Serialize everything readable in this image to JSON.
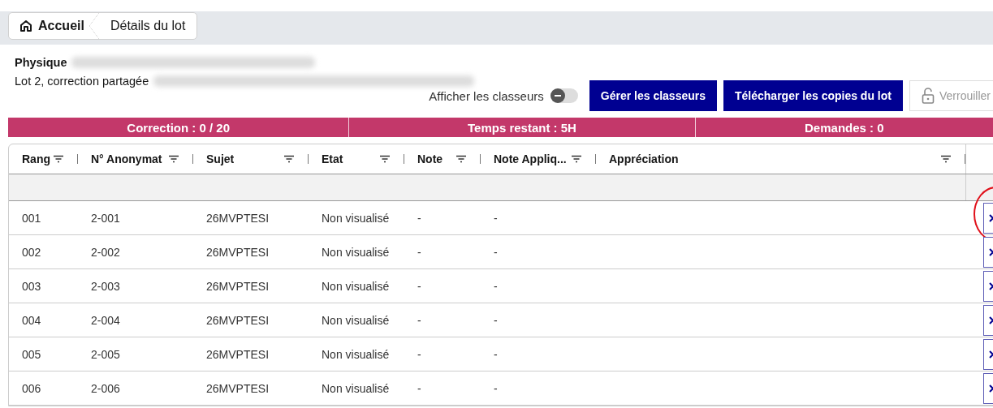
{
  "breadcrumb": [
    {
      "label": "Accueil",
      "kind": "home"
    },
    {
      "label": "Détails du lot",
      "kind": "page"
    }
  ],
  "header": {
    "subject": "Physique",
    "lot": "Lot 2, correction partagée"
  },
  "toolbar": {
    "toggle": {
      "label": "Afficher les classeurs",
      "on": false
    },
    "buttons": [
      {
        "label": "Gérer les classeurs",
        "kind": "primary"
      },
      {
        "label": "Télécharger les copies du lot",
        "kind": "primary"
      },
      {
        "label": "Verrouiller",
        "kind": "lock"
      }
    ]
  },
  "status_bar": [
    "Correction : 0 / 20",
    "Temps restant : 5H",
    "Demandes : 0"
  ],
  "table": {
    "columns": [
      {
        "label": "Rang"
      },
      {
        "label": "N° Anonymat"
      },
      {
        "label": "Sujet"
      },
      {
        "label": "Etat"
      },
      {
        "label": "Note"
      },
      {
        "label": "Note Appliq..."
      },
      {
        "label": "Appréciation"
      }
    ],
    "rows": [
      {
        "cells": [
          "001",
          "2-001",
          "26MVPTESI",
          "Non visualisé",
          "-",
          "-"
        ],
        "highlighted": true
      },
      {
        "cells": [
          "002",
          "2-002",
          "26MVPTESI",
          "Non visualisé",
          "-",
          "-"
        ],
        "highlighted": false
      },
      {
        "cells": [
          "003",
          "2-003",
          "26MVPTESI",
          "Non visualisé",
          "-",
          "-"
        ],
        "highlighted": false
      },
      {
        "cells": [
          "004",
          "2-004",
          "26MVPTESI",
          "Non visualisé",
          "-",
          "-"
        ],
        "highlighted": false
      },
      {
        "cells": [
          "005",
          "2-005",
          "26MVPTESI",
          "Non visualisé",
          "-",
          "-"
        ],
        "highlighted": false
      },
      {
        "cells": [
          "006",
          "2-006",
          "26MVPTESI",
          "Non visualisé",
          "-",
          "-"
        ],
        "highlighted": false
      }
    ]
  }
}
